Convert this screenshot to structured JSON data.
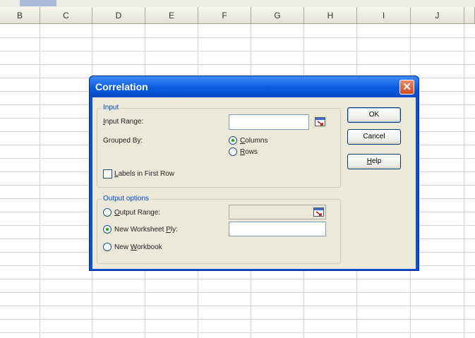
{
  "spreadsheet": {
    "columns": [
      "B",
      "C",
      "D",
      "E",
      "F",
      "G",
      "H",
      "I",
      "J"
    ]
  },
  "dialog": {
    "title": "Correlation",
    "close_glyph": "✕",
    "input_group": {
      "legend": "Input",
      "input_range_label_u": "I",
      "input_range_label_rest": "nput Range:",
      "input_range_value": "",
      "grouped_by_label": "Grouped By:",
      "columns_u": "C",
      "columns_rest": "olumns",
      "rows_u": "R",
      "rows_rest": "ows",
      "grouped_by_selected": "Columns",
      "labels_pre": "",
      "labels_u": "L",
      "labels_rest": "abels in First Row",
      "labels_checked": false
    },
    "output_group": {
      "legend": "Output options",
      "output_range_u": "O",
      "output_range_rest": "utput Range:",
      "new_ws_pre": "New Worksheet ",
      "new_ws_u": "P",
      "new_ws_rest": "ly:",
      "new_wb_pre": "New ",
      "new_wb_u": "W",
      "new_wb_rest": "orkbook",
      "selected": "New Worksheet Ply",
      "output_range_value": "",
      "new_worksheet_value": ""
    },
    "buttons": {
      "ok": "OK",
      "cancel": "Cancel",
      "help_u": "H",
      "help_rest": "elp"
    },
    "icons": {
      "range_picker": "collapse-dialog-icon",
      "close": "close-icon"
    }
  }
}
